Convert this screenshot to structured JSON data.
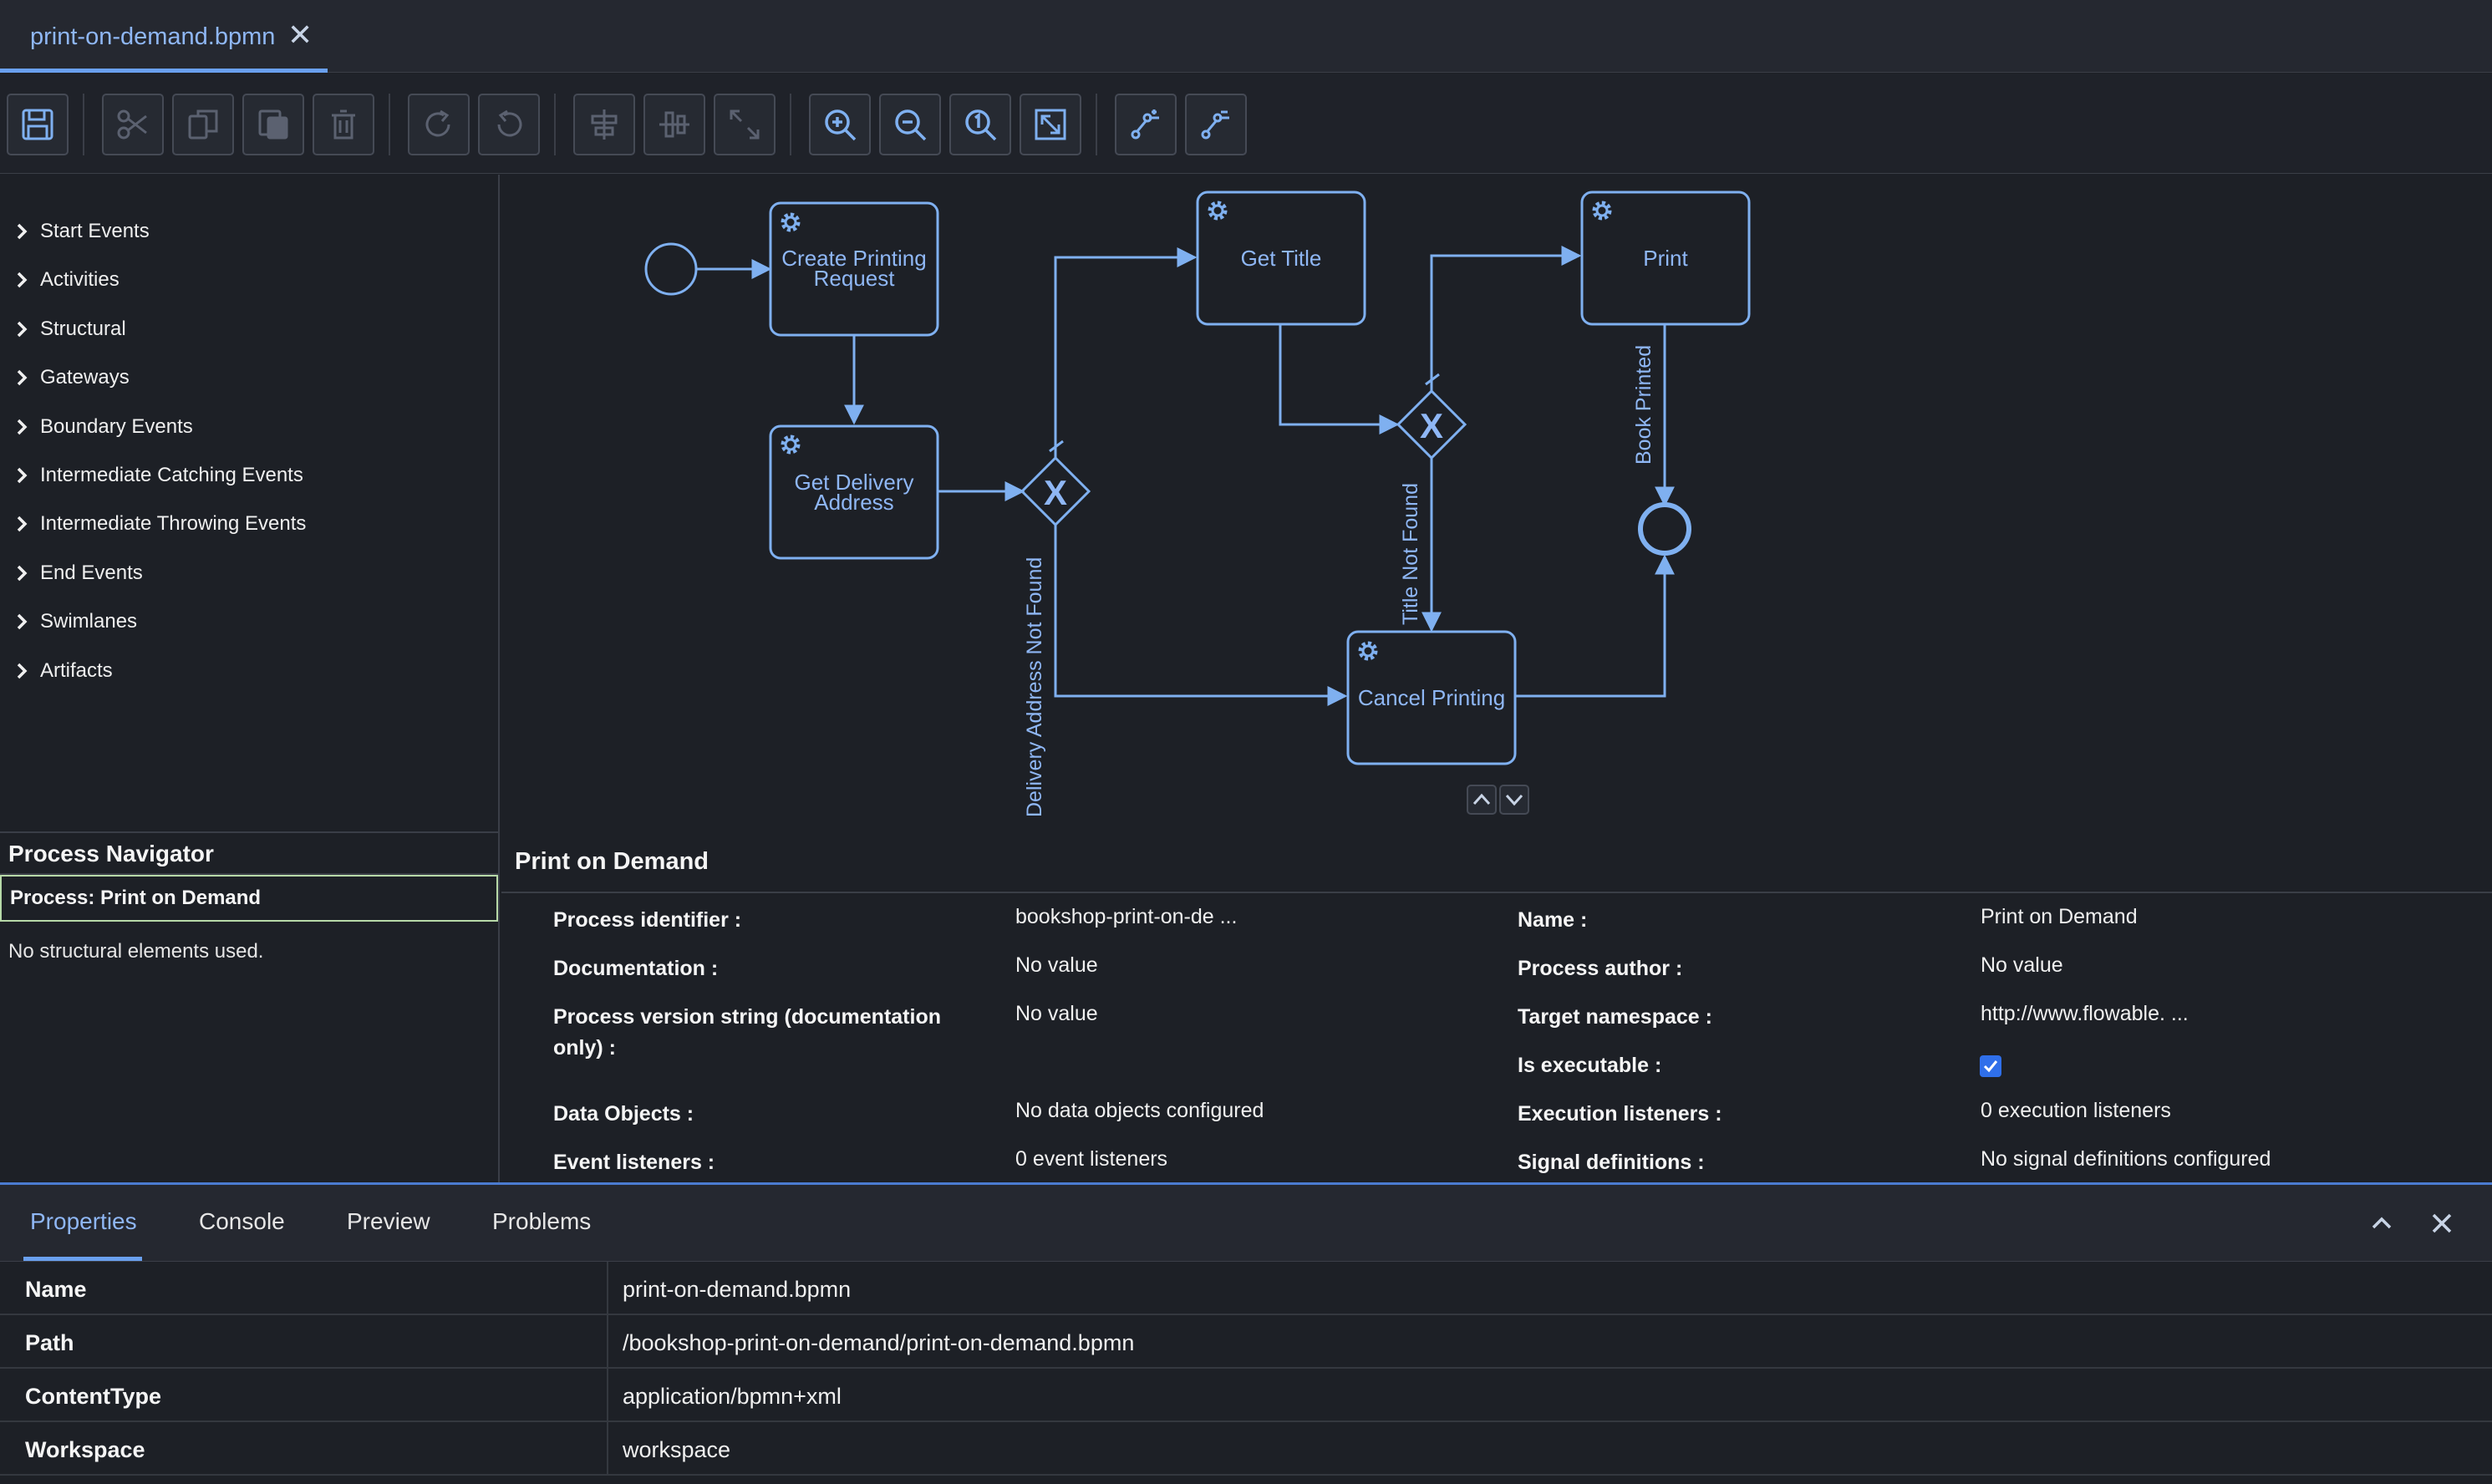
{
  "tab": {
    "file_name": "print-on-demand.bpmn",
    "close_glyph": "✕"
  },
  "toolbar": {
    "buttons": [
      "save-icon",
      "cut-icon",
      "copy-icon",
      "paste-icon",
      "delete-icon",
      "redo-icon",
      "undo-icon",
      "align-horizontal-icon",
      "align-vertical-icon",
      "resize-icon",
      "zoom-in-icon",
      "zoom-out-icon",
      "zoom-actual-icon",
      "zoom-fit-icon",
      "add-bendpoint-icon",
      "remove-bendpoint-icon"
    ]
  },
  "palette": {
    "items": [
      "Start Events",
      "Activities",
      "Structural",
      "Gateways",
      "Boundary Events",
      "Intermediate Catching Events",
      "Intermediate Throwing Events",
      "End Events",
      "Swimlanes",
      "Artifacts"
    ]
  },
  "diagram": {
    "color": "#7fb0f0",
    "tasks": {
      "create": [
        "Create Printing",
        "Request"
      ],
      "delivery": [
        "Get Delivery",
        "Address"
      ],
      "title": "Get Title",
      "print": "Print",
      "cancel": "Cancel Printing"
    },
    "flows": {
      "delivery_not_found": "Delivery Address Not Found",
      "title_not_found": "Title Not Found",
      "book_printed": "Book Printed"
    },
    "gateway_glyph": "X"
  },
  "navigator": {
    "title": "Process Navigator",
    "process": "Process: Print on Demand",
    "empty_text": "No structural elements used."
  },
  "process_props": {
    "title": "Print on Demand",
    "left": [
      {
        "label": "Process identifier :",
        "value": "bookshop-print-on-de ..."
      },
      {
        "label": "Documentation :",
        "value": "No value"
      },
      {
        "label": "Process version string (documentation",
        "label2": "only) :",
        "value": "No value"
      },
      {
        "label": "Data Objects :",
        "value": "No data objects configured"
      },
      {
        "label": "Event listeners :",
        "value": "0 event listeners"
      }
    ],
    "right": [
      {
        "label": "Name :",
        "value": "Print on Demand"
      },
      {
        "label": "Process author :",
        "value": "No value"
      },
      {
        "label": "Target namespace :",
        "value": "http://www.flowable. ..."
      },
      {
        "label": "Is executable :",
        "value": ""
      },
      {
        "label": "Execution listeners :",
        "value": "0 execution listeners"
      },
      {
        "label": "Signal definitions :",
        "value": "No signal definitions configured"
      }
    ],
    "is_executable": true
  },
  "bottom": {
    "tabs": [
      "Properties",
      "Console",
      "Preview",
      "Problems"
    ],
    "active_tab": "Properties",
    "rows": [
      {
        "key": "Name",
        "value": "print-on-demand.bpmn"
      },
      {
        "key": "Path",
        "value": "/bookshop-print-on-demand/print-on-demand.bpmn"
      },
      {
        "key": "ContentType",
        "value": "application/bpmn+xml"
      },
      {
        "key": "Workspace",
        "value": "workspace"
      }
    ]
  }
}
